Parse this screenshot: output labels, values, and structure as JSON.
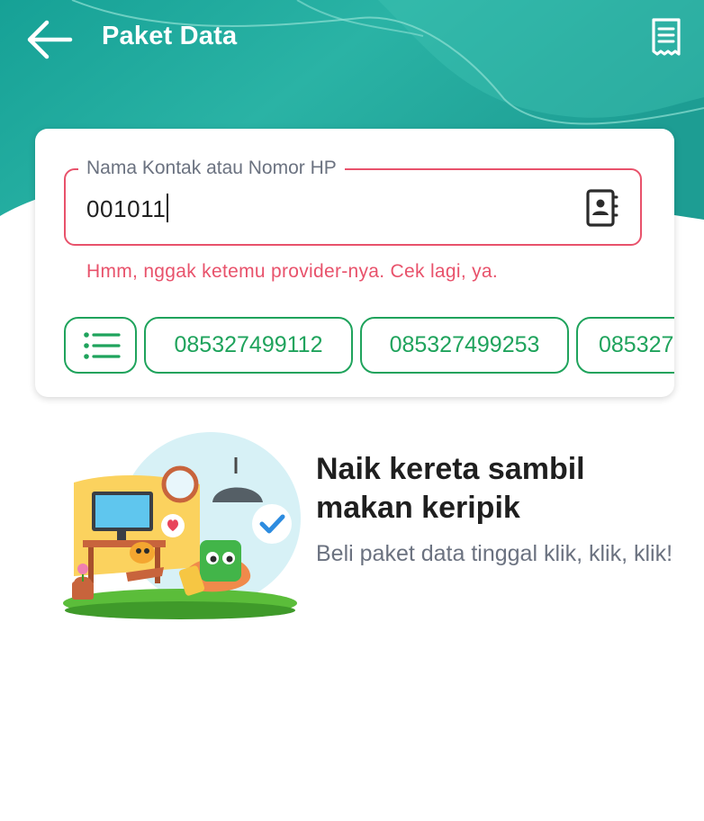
{
  "header": {
    "title": "Paket Data",
    "back_icon": "arrow-left-icon",
    "history_icon": "receipt-icon",
    "bg_colors": [
      "#1aa39b",
      "#35bfb0"
    ]
  },
  "form": {
    "field_label": "Nama Kontak atau Nomor HP",
    "field_value": "001011",
    "contact_icon": "contact-book-icon",
    "error_message": "Hmm, nggak ketemu provider-nya. Cek lagi, ya.",
    "error_color": "#e8526b"
  },
  "recent_numbers": {
    "menu_icon": "list-icon",
    "items": [
      "085327499112",
      "085327499253",
      "085327"
    ],
    "accent_color": "#1fa35c"
  },
  "promo": {
    "title": "Naik kereta sambil makan keripik",
    "subtitle": "Beli paket data tinggal klik, klik, klik!",
    "image_icon": "living-room-illustration"
  }
}
